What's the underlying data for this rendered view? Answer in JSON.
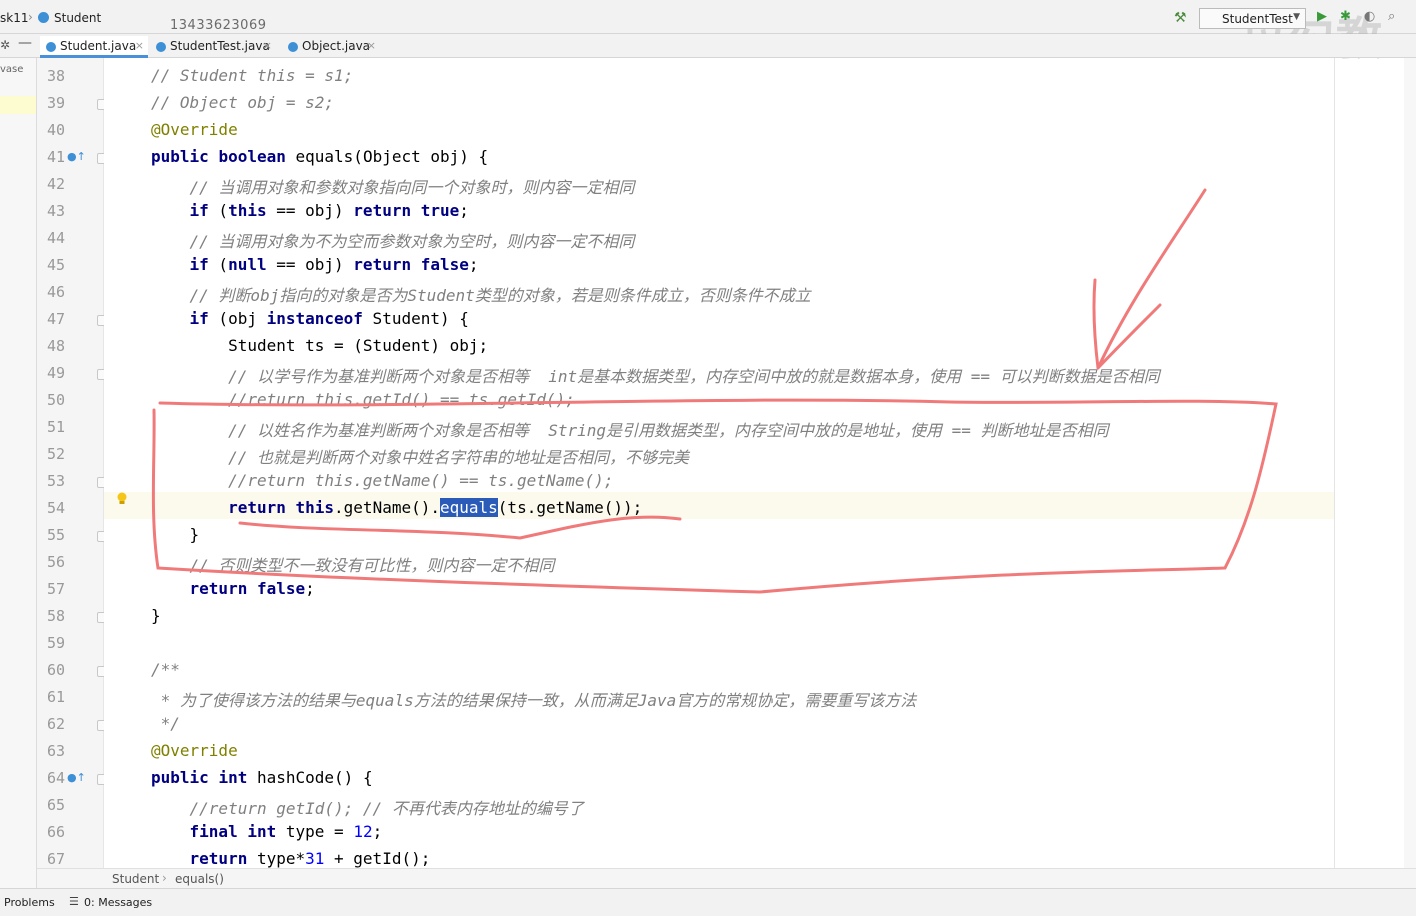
{
  "navbar": {
    "project_crumb": "sk11",
    "class_crumb": "Student",
    "phone_number": "13433623069",
    "run_config": "StudentTest"
  },
  "tabs": [
    {
      "label": "Student.java",
      "active": true
    },
    {
      "label": "StudentTest.java",
      "active": false
    },
    {
      "label": "Object.java",
      "active": false
    }
  ],
  "project_strip_label": "vase",
  "editor": {
    "lines": [
      {
        "n": "38",
        "text": "// Student this = s1;"
      },
      {
        "n": "39",
        "text": "// Object obj = s2;"
      },
      {
        "n": "40",
        "text": "@Override"
      },
      {
        "n": "41",
        "text": "public boolean equals(Object obj) {"
      },
      {
        "n": "42",
        "text": "    // 当调用对象和参数对象指向同一个对象时，则内容一定相同"
      },
      {
        "n": "43",
        "text": "    if (this == obj) return true;"
      },
      {
        "n": "44",
        "text": "    // 当调用对象为不为空而参数对象为空时，则内容一定不相同"
      },
      {
        "n": "45",
        "text": "    if (null == obj) return false;"
      },
      {
        "n": "46",
        "text": "    // 判断obj指向的对象是否为Student类型的对象，若是则条件成立，否则条件不成立"
      },
      {
        "n": "47",
        "text": "    if (obj instanceof Student) {"
      },
      {
        "n": "48",
        "text": "        Student ts = (Student) obj;"
      },
      {
        "n": "49",
        "text": "        // 以学号作为基准判断两个对象是否相等  int是基本数据类型，内存空间中放的就是数据本身，使用 == 可以判断数据是否相同"
      },
      {
        "n": "50",
        "text": "        //return this.getId() == ts.getId();"
      },
      {
        "n": "51",
        "text": "        // 以姓名作为基准判断两个对象是否相等  String是引用数据类型，内存空间中放的是地址，使用 == 判断地址是否相同"
      },
      {
        "n": "52",
        "text": "        // 也就是判断两个对象中姓名字符串的地址是否相同，不够完美"
      },
      {
        "n": "53",
        "text": "        //return this.getName() == ts.getName();"
      },
      {
        "n": "54",
        "text": "        return this.getName().equals(ts.getName());"
      },
      {
        "n": "55",
        "text": "    }"
      },
      {
        "n": "56",
        "text": "    // 否则类型不一致没有可比性，则内容一定不相同"
      },
      {
        "n": "57",
        "text": "    return false;"
      },
      {
        "n": "58",
        "text": "}"
      },
      {
        "n": "59",
        "text": ""
      },
      {
        "n": "60",
        "text": "/**"
      },
      {
        "n": "61",
        "text": " * 为了使得该方法的结果与equals方法的结果保持一致，从而满足Java官方的常规协定，需要重写该方法"
      },
      {
        "n": "62",
        "text": " */"
      },
      {
        "n": "63",
        "text": "@Override"
      },
      {
        "n": "64",
        "text": "public int hashCode() {"
      },
      {
        "n": "65",
        "text": "    //return getId(); // 不再代表内存地址的编号了"
      },
      {
        "n": "66",
        "text": "    final int type = 12;"
      },
      {
        "n": "67",
        "text": "    return type*31 + getId();"
      }
    ]
  },
  "breadcrumb": {
    "class": "Student",
    "method": "equals()"
  },
  "bottom_tabs": {
    "problems": "Problems",
    "messages": "0: Messages"
  },
  "colors": {
    "keyword": "#000080",
    "comment": "#808080",
    "annotation": "#808000",
    "number": "#0000ff",
    "selection": "#2a5bb8",
    "pen_markup": "#f07a7a"
  }
}
